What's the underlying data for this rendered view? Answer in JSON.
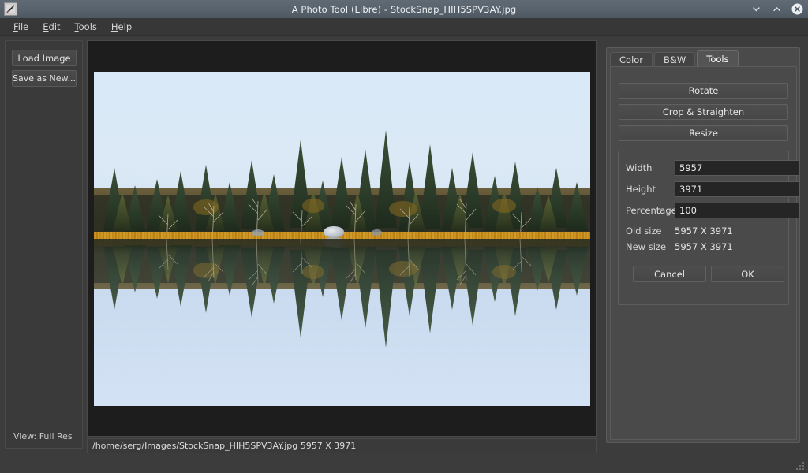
{
  "window": {
    "title": "A Photo Tool (Libre) - StockSnap_HIH5SPV3AY.jpg",
    "app_icon": "photo-tool-icon",
    "controls": {
      "minimize": "chevron-down-icon",
      "maximize": "chevron-up-icon",
      "close": "close-icon"
    }
  },
  "menubar": {
    "items": [
      {
        "label": "File",
        "mnemonic": "F",
        "rest": "ile"
      },
      {
        "label": "Edit",
        "mnemonic": "E",
        "rest": "dit"
      },
      {
        "label": "Tools",
        "mnemonic": "T",
        "rest": "ools"
      },
      {
        "label": "Help",
        "mnemonic": "H",
        "rest": "elp"
      }
    ]
  },
  "sidebar": {
    "load_label": "Load Image",
    "save_label": "Save as New...",
    "view_label": "View: Full Res"
  },
  "statusbar": {
    "text": "/home/serg/Images/StockSnap_HIH5SPV3AY.jpg 5957 X 3971"
  },
  "panel": {
    "tabs": [
      {
        "label": "Color",
        "active": false
      },
      {
        "label": "B&W",
        "active": false
      },
      {
        "label": "Tools",
        "active": true
      }
    ],
    "tools": {
      "rotate_label": "Rotate",
      "crop_label": "Crop & Straighten",
      "resize_label": "Resize"
    },
    "resize": {
      "width_label": "Width",
      "width_value": "5957",
      "height_label": "Height",
      "height_value": "3971",
      "percentage_label": "Percentage",
      "percentage_value": "100",
      "old_size_label": "Old size",
      "old_size_value": "5957 X 3971",
      "new_size_label": "New size",
      "new_size_value": "5957 X 3971",
      "cancel_label": "Cancel",
      "ok_label": "OK"
    }
  },
  "photo": {
    "description": "Winter shoreline of conifer forest mirrored in still lake water with golden reed band at the waterline",
    "colors": {
      "sky": "#dae9f7",
      "water": "#c9daf0",
      "reeds": "#c98b16",
      "conifer": "#2c3a2a",
      "canvas_background": "#1d1d1d"
    }
  },
  "theme": {
    "titlebar": "#59646f",
    "menubar": "#373737",
    "window_background": "#3c3c3c",
    "panel_background": "#4a4a4a",
    "text": "#dcdcdc"
  }
}
